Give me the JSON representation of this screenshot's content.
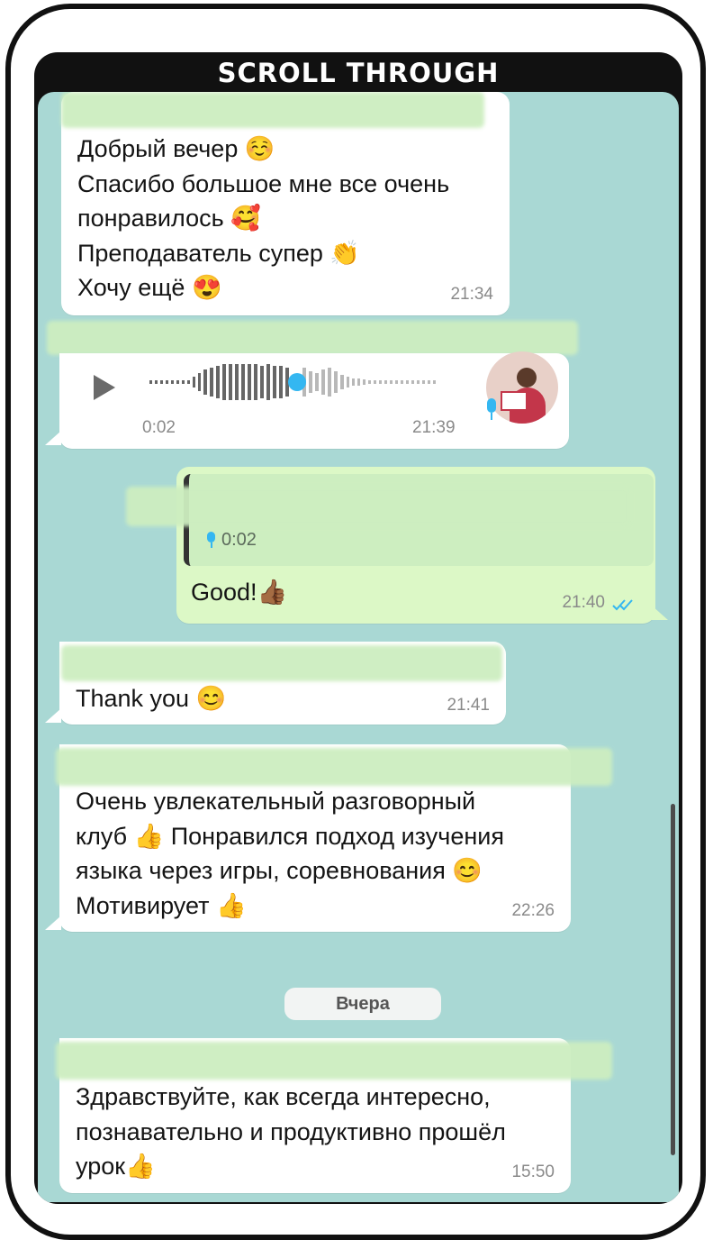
{
  "header": {
    "title": "SCROLL THROUGH"
  },
  "messages": [
    {
      "id": "m1",
      "direction": "in",
      "text": "Добрый вечер ☺️\nСпасибо большое мне все очень\nпонравилось 🥰\nПреподаватель супер 👏\nХочу ещё 😍",
      "time": "21:34"
    },
    {
      "id": "m2",
      "direction": "in",
      "type": "voice",
      "duration": "0:02",
      "time": "21:39",
      "progress": 0.45
    },
    {
      "id": "m3",
      "direction": "out",
      "quote_duration": "0:02",
      "text": "Good!👍🏾",
      "time": "21:40",
      "read": true
    },
    {
      "id": "m4",
      "direction": "in",
      "text": "Thank you 😊",
      "time": "21:41"
    },
    {
      "id": "m5",
      "direction": "in",
      "text": "Очень увлекательный разговорный\nклуб 👍 Понравился подход изучения\nязыка через игры, соревнования 😊\nМотивирует 👍",
      "time": "22:26"
    },
    {
      "id": "m6",
      "direction": "in",
      "text": "Здравствуйте,  как всегда интересно,\nпознавательно и продуктивно прошёл\nурок👍",
      "time": "15:50"
    }
  ],
  "date_separator": "Вчера",
  "colors": {
    "chat_bg": "#a9d8d4",
    "incoming": "#ffffff",
    "outgoing": "#dcf8c6",
    "accent_blue": "#34b7f1"
  },
  "icons": [
    "play-icon",
    "microphone-icon",
    "double-check-icon"
  ]
}
